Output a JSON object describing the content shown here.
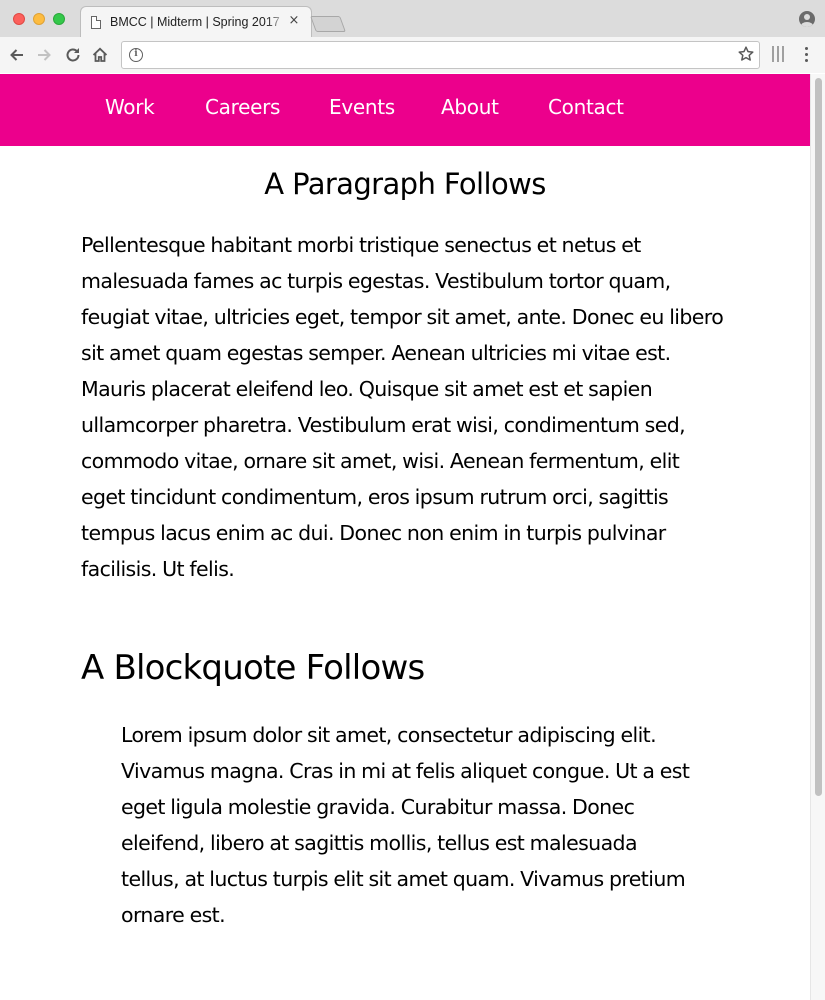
{
  "browser": {
    "tab_title": "BMCC | Midterm | Spring 2017",
    "tab_close_glyph": "×",
    "address_text": "",
    "icons": [
      "document-icon",
      "close-icon",
      "profile-icon",
      "back-arrow-icon",
      "forward-arrow-icon",
      "reload-icon",
      "home-icon",
      "info-icon",
      "star-icon",
      "extensions-icon",
      "menu-icon"
    ]
  },
  "site": {
    "nav": {
      "background": "#ec008c",
      "items": [
        "Work",
        "Careers",
        "Events",
        "About",
        "Contact"
      ]
    },
    "paragraph_heading": "A Paragraph Follows",
    "paragraph": "Pellentesque habitant morbi tristique senectus et netus et malesuada fames ac turpis egestas. Vestibulum tortor quam, feugiat vitae, ultricies eget, tempor sit amet, ante. Donec eu libero sit amet quam egestas semper. Aenean ultricies mi vitae est. Mauris placerat eleifend leo. Quisque sit amet est et sapien ullamcorper pharetra. Vestibulum erat wisi, condimentum sed, commodo vitae, ornare sit amet, wisi. Aenean fermentum, elit eget tincidunt condimentum, eros ipsum rutrum orci, sagittis tempus lacus enim ac dui. Donec non enim in turpis pulvinar facilisis. Ut felis.",
    "blockquote_heading": "A Blockquote Follows",
    "blockquote": "Lorem ipsum dolor sit amet, consectetur adipiscing elit. Vivamus magna. Cras in mi at felis aliquet congue. Ut a est eget ligula molestie gravida. Curabitur massa. Donec eleifend, libero at sagittis mollis, tellus est malesuada tellus, at luctus turpis elit sit amet quam. Vivamus pretium ornare est."
  }
}
